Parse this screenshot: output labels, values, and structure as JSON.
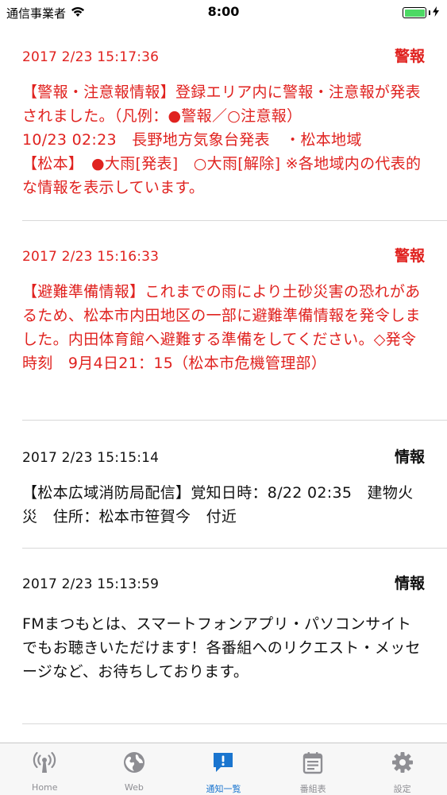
{
  "status_bar": {
    "carrier": "通信事業者",
    "time": "8:00"
  },
  "notifications": [
    {
      "timestamp": "2017 2/23 15:17:36",
      "badge": "警報",
      "body": "【警報・注意報情報】登録エリア内に警報・注意報が発表されました。（凡例：●警報／○注意報）\n10/23 02:23　長野地方気象台発表　・松本地域\n【松本】　●大雨[発表]　○大雨[解除] ※各地域内の代表的な情報を表示しています。",
      "color": "#e0221f"
    },
    {
      "timestamp": "2017 2/23 15:16:33",
      "badge": "警報",
      "body": "【避難準備情報】これまでの雨により土砂災害の恐れがあるため、松本市内田地区の一部に避難準備情報を発令しました。内田体育館へ避難する準備をしてください。◇発令時刻　9月4日21：15（松本市危機管理部）",
      "color": "#e0221f"
    },
    {
      "timestamp": "2017 2/23 15:15:14",
      "badge": "情報",
      "body": "【松本広域消防局配信】覚知日時：8/22 02:35　建物火災　住所：松本市笹賀今　付近",
      "color": "#111111"
    },
    {
      "timestamp": "2017 2/23 15:13:59",
      "badge": "情報",
      "body": "FMまつもとは、スマートフォンアプリ・パソコンサイトでもお聴きいただけます！各番組へのリクエスト・メッセージなど、お待ちしております。",
      "color": "#111111"
    }
  ],
  "tabbar": {
    "tabs": [
      {
        "label": "Home",
        "icon": "radio-tower-icon"
      },
      {
        "label": "Web",
        "icon": "globe-icon"
      },
      {
        "label": "通知一覧",
        "icon": "notification-bubble-icon",
        "active": true
      },
      {
        "label": "番組表",
        "icon": "calendar-icon"
      },
      {
        "label": "設定",
        "icon": "gear-icon"
      }
    ],
    "active_color": "#1a75cf",
    "inactive_color": "#8e8e93"
  }
}
